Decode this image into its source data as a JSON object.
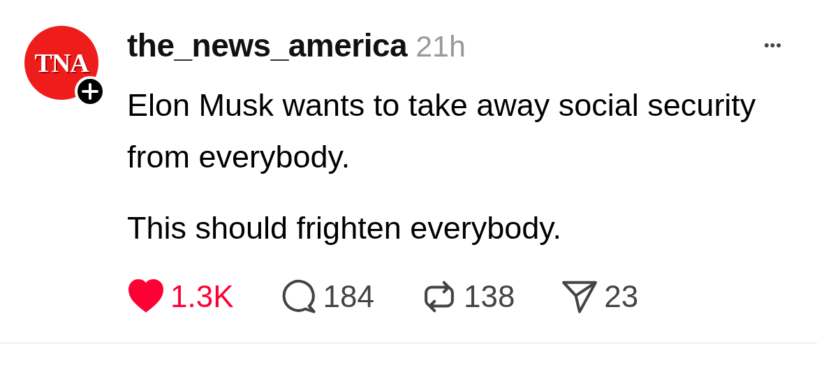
{
  "post": {
    "avatar": {
      "text": "TNA",
      "following": false
    },
    "username": "the_news_america",
    "time": "21h",
    "more": "•••",
    "paragraphs": [
      "Elon Musk wants to take away social security from everybody.",
      "This should frighten everybody."
    ],
    "actions": [
      {
        "kind": "like",
        "count": "1.3K",
        "liked": true
      },
      {
        "kind": "reply",
        "count": "184"
      },
      {
        "kind": "repost",
        "count": "138"
      },
      {
        "kind": "share",
        "count": "23"
      }
    ]
  }
}
